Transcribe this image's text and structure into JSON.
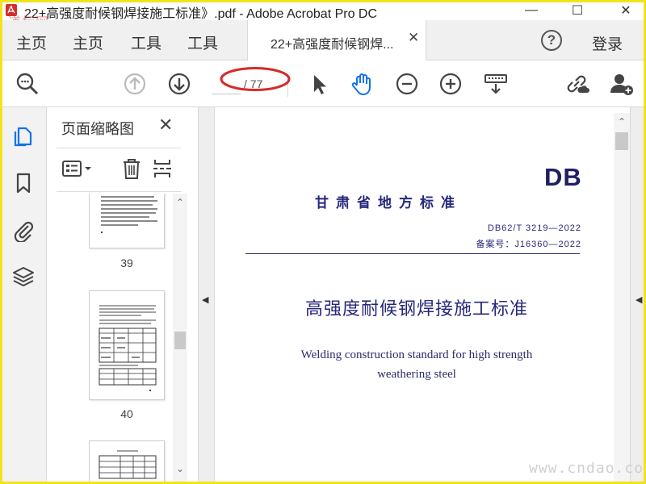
{
  "window": {
    "title": "22+高强度耐候钢焊接施工标准》.pdf - Adobe Acrobat Pro DC",
    "minimize_glyph": "—",
    "maximize_glyph": "☐",
    "close_glyph": "✕",
    "watermark_top": "道标网"
  },
  "tabs": {
    "nav": [
      "主页",
      "主页",
      "工具",
      "工具"
    ],
    "document_tab": "22+高强度耐候钢焊...",
    "document_tab_close": "✕",
    "help": "?",
    "login": "登录"
  },
  "toolbar": {
    "page_current": "",
    "page_total": "/ 77",
    "icons": [
      "search-icon",
      "page-up-icon",
      "page-down-icon",
      "select-arrow-icon",
      "hand-icon",
      "zoom-out-icon",
      "zoom-in-icon",
      "keyboard-icon",
      "share-link-icon",
      "add-user-icon"
    ]
  },
  "sidebar": {
    "icons": [
      "pages-icon",
      "bookmark-icon",
      "attachment-icon",
      "layers-icon"
    ]
  },
  "thumbnails_panel": {
    "title": "页面缩略图",
    "close": "✕",
    "thumbnails": [
      {
        "page": "39"
      },
      {
        "page": "40"
      }
    ]
  },
  "document": {
    "logo": "DB",
    "local_standard": "甘肃省地方标准",
    "standard_number": "DB62/T 3219—2022",
    "filing_number": "备案号：J16360—2022",
    "title_cn": "高强度耐候钢焊接施工标准",
    "title_en_line1": "Welding construction standard for high strength",
    "title_en_line2": "weathering steel"
  },
  "watermark_bottom": "www.cndao.com",
  "colors": {
    "accent": "#1473e6",
    "annotation_red": "#d62a2a",
    "frame_yellow": "#f4e21b",
    "doc_navy": "#26287a"
  }
}
